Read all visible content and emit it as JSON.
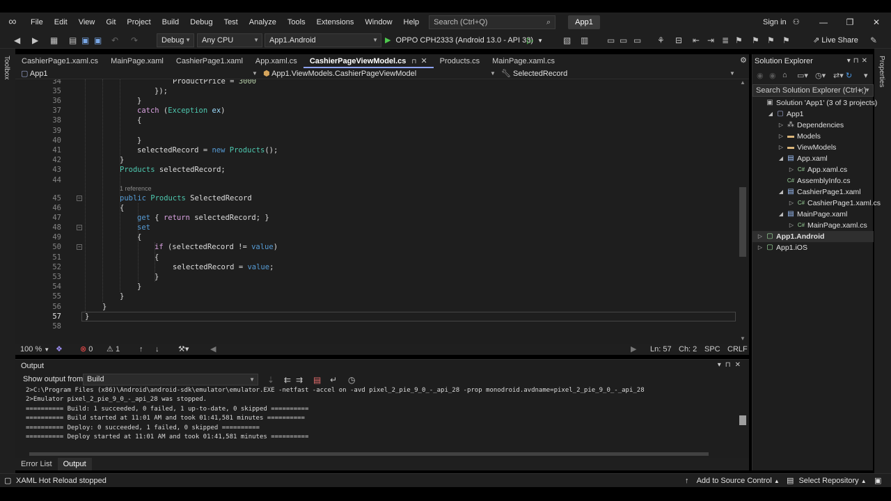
{
  "menubar": {
    "items": [
      "File",
      "Edit",
      "View",
      "Git",
      "Project",
      "Build",
      "Debug",
      "Test",
      "Analyze",
      "Tools",
      "Extensions",
      "Window",
      "Help"
    ],
    "search_placeholder": "Search (Ctrl+Q)",
    "solution_name": "App1",
    "sign_in": "Sign in"
  },
  "toolbar": {
    "config": "Debug",
    "platform": "Any CPU",
    "startup_project": "App1.Android",
    "run_target": "OPPO CPH2333 (Android 13.0 - API 33)",
    "live_share": "Live Share"
  },
  "side_rails": {
    "left": "Toolbox",
    "right": "Properties"
  },
  "editor_tabs": [
    {
      "label": "CashierPage1.xaml.cs",
      "active": false
    },
    {
      "label": "MainPage.xaml",
      "active": false
    },
    {
      "label": "CashierPage1.xaml",
      "active": false
    },
    {
      "label": "App.xaml.cs",
      "active": false
    },
    {
      "label": "CashierPageViewModel.cs",
      "active": true
    },
    {
      "label": "Products.cs",
      "active": false
    },
    {
      "label": "MainPage.xaml.cs",
      "active": false
    }
  ],
  "navbar": {
    "project": "App1",
    "type": "App1.ViewModels.CashierPageViewModel",
    "member": "SelectedRecord"
  },
  "code": {
    "current_line": "57",
    "ref_hint": "1 reference",
    "lines": [
      {
        "n": "34",
        "c": "ProductPrice = 3000"
      },
      {
        "n": "35",
        "c": "});"
      },
      {
        "n": "36",
        "c": "}"
      },
      {
        "n": "37",
        "c": "catch (Exception ex)"
      },
      {
        "n": "38",
        "c": "{"
      },
      {
        "n": "39",
        "c": ""
      },
      {
        "n": "40",
        "c": "}"
      },
      {
        "n": "41",
        "c": "selectedRecord = new Products();"
      },
      {
        "n": "42",
        "c": "}"
      },
      {
        "n": "43",
        "c": "Products selectedRecord;"
      },
      {
        "n": "44",
        "c": ""
      },
      {
        "n": "45",
        "c": "public Products SelectedRecord"
      },
      {
        "n": "46",
        "c": "{"
      },
      {
        "n": "47",
        "c": "get { return selectedRecord; }"
      },
      {
        "n": "48",
        "c": "set"
      },
      {
        "n": "49",
        "c": "{"
      },
      {
        "n": "50",
        "c": "if (selectedRecord != value)"
      },
      {
        "n": "51",
        "c": "{"
      },
      {
        "n": "52",
        "c": "selectedRecord = value;"
      },
      {
        "n": "53",
        "c": "}"
      },
      {
        "n": "54",
        "c": "}"
      },
      {
        "n": "55",
        "c": "}"
      },
      {
        "n": "56",
        "c": "}"
      },
      {
        "n": "57",
        "c": "}"
      },
      {
        "n": "58",
        "c": ""
      }
    ]
  },
  "editor_status": {
    "zoom": "100 %",
    "errors": "0",
    "warnings": "1",
    "line": "Ln: 57",
    "char": "Ch: 2",
    "indent": "SPC",
    "eol": "CRLF"
  },
  "output": {
    "title": "Output",
    "show_from_label": "Show output from:",
    "source": "Build",
    "lines": [
      "2>C:\\Program Files (x86)\\Android\\android-sdk\\emulator\\emulator.EXE -netfast -accel on -avd pixel_2_pie_9_0_-_api_28 -prop monodroid.avdname=pixel_2_pie_9_0_-_api_28",
      "2>Emulator pixel_2_pie_9_0_-_api_28 was stopped.",
      "========== Build: 1 succeeded, 0 failed, 1 up-to-date, 0 skipped ==========",
      "========== Build started at 11:01 AM and took 01:41,581 minutes ==========",
      "========== Deploy: 0 succeeded, 1 failed, 0 skipped ==========",
      "========== Deploy started at 11:01 AM and took 01:41,581 minutes =========="
    ]
  },
  "bottom_tabs": [
    {
      "label": "Error List",
      "active": false
    },
    {
      "label": "Output",
      "active": true
    }
  ],
  "solution_explorer": {
    "title": "Solution Explorer",
    "search_placeholder": "Search Solution Explorer (Ctrl+;)",
    "nodes": [
      {
        "label": "Solution 'App1' (3 of 3 projects)",
        "icon": "solution-icon",
        "depth": 0,
        "twisty": ""
      },
      {
        "label": "App1",
        "icon": "csharp-project-icon",
        "depth": 1,
        "twisty": "down"
      },
      {
        "label": "Dependencies",
        "icon": "dependencies-icon",
        "depth": 2,
        "twisty": "right"
      },
      {
        "label": "Models",
        "icon": "folder-icon",
        "depth": 2,
        "twisty": "right"
      },
      {
        "label": "ViewModels",
        "icon": "folder-icon",
        "depth": 2,
        "twisty": "right"
      },
      {
        "label": "App.xaml",
        "icon": "xaml-file-icon",
        "depth": 2,
        "twisty": "down"
      },
      {
        "label": "App.xaml.cs",
        "icon": "csharp-file-icon",
        "depth": 3,
        "twisty": "right"
      },
      {
        "label": "AssemblyInfo.cs",
        "icon": "csharp-file-icon",
        "depth": 2,
        "twisty": ""
      },
      {
        "label": "CashierPage1.xaml",
        "icon": "xaml-file-icon",
        "depth": 2,
        "twisty": "down"
      },
      {
        "label": "CashierPage1.xaml.cs",
        "icon": "csharp-file-icon",
        "depth": 3,
        "twisty": "right"
      },
      {
        "label": "MainPage.xaml",
        "icon": "xaml-file-icon",
        "depth": 2,
        "twisty": "down"
      },
      {
        "label": "MainPage.xaml.cs",
        "icon": "csharp-file-icon",
        "depth": 3,
        "twisty": "right"
      },
      {
        "label": "App1.Android",
        "icon": "android-project-icon",
        "depth": 0,
        "twisty": "right",
        "bold": true,
        "selected": true
      },
      {
        "label": "App1.iOS",
        "icon": "ios-project-icon",
        "depth": 0,
        "twisty": "right"
      }
    ]
  },
  "statusbar": {
    "left": "XAML Hot Reload stopped",
    "source_control": "Add to Source Control",
    "repository": "Select Repository"
  }
}
